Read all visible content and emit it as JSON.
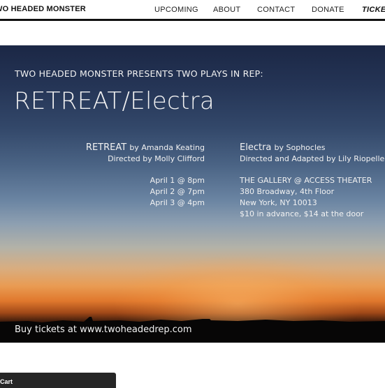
{
  "header": {
    "brand": "WO HEADED MONSTER",
    "nav": [
      "UPCOMING",
      "ABOUT",
      "CONTACT",
      "DONATE",
      "TICKET"
    ]
  },
  "banner": {
    "eyebrow": "TWO HEADED MONSTER PRESENTS TWO PLAYS IN REP:",
    "title": "RETREAT/Electra",
    "play1": {
      "name": "RETREAT",
      "author": "by Amanda Keating",
      "director": "Directed by Molly Clifford",
      "dates": [
        "April 1 @ 8pm",
        "April 2 @ 7pm",
        "April 3 @ 4pm"
      ]
    },
    "play2": {
      "name": "Electra",
      "author": "by Sophocles",
      "director": "Directed and Adapted by Lily Riopelle"
    },
    "venue": [
      "THE GALLERY @ ACCESS THEATER",
      "380 Broadway, 4th Floor",
      "New York, NY 10013",
      "$10 in advance, $14 at the door"
    ],
    "buy": "Buy tickets at www.twoheadedrep.com"
  },
  "cart": {
    "label": "g Cart"
  },
  "colors": {
    "accent_rule": "#111111",
    "cart_bg": "#262626",
    "sky_top": "#1b2745",
    "sunset": "#e99b52"
  }
}
